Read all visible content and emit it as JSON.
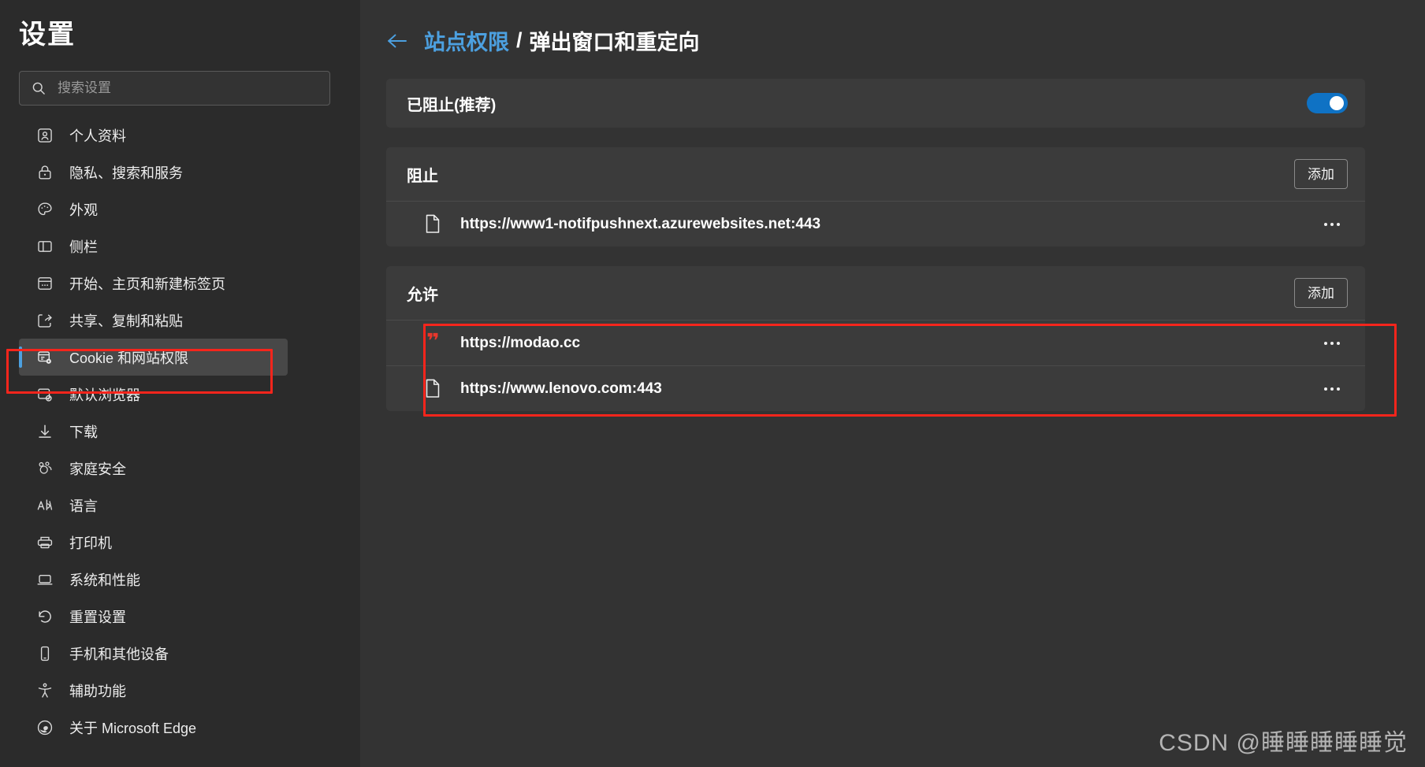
{
  "window": {
    "title": "设置",
    "theme_bg": "#333333",
    "sidebar_bg": "#2B2B2B",
    "card_bg": "#3B3B3B",
    "accent_color": "#4CA0E0",
    "toggle_on_color": "#0F72C4",
    "annotation_color": "#F6251C"
  },
  "sidebar": {
    "title": "设置",
    "search": {
      "placeholder": "搜索设置",
      "value": "",
      "icon": "search-icon"
    },
    "items": [
      {
        "label": "个人资料",
        "icon": "profile-icon",
        "selected": false
      },
      {
        "label": "隐私、搜索和服务",
        "icon": "lock-icon",
        "selected": false
      },
      {
        "label": "外观",
        "icon": "palette-icon",
        "selected": false
      },
      {
        "label": "侧栏",
        "icon": "sidebar-panel-icon",
        "selected": false
      },
      {
        "label": "开始、主页和新建标签页",
        "icon": "new-tab-icon",
        "selected": false
      },
      {
        "label": "共享、复制和粘贴",
        "icon": "share-icon",
        "selected": false
      },
      {
        "label": "Cookie 和网站权限",
        "icon": "cookie-settings-icon",
        "selected": true
      },
      {
        "label": "默认浏览器",
        "icon": "default-browser-icon",
        "selected": false
      },
      {
        "label": "下载",
        "icon": "download-icon",
        "selected": false
      },
      {
        "label": "家庭安全",
        "icon": "family-icon",
        "selected": false
      },
      {
        "label": "语言",
        "icon": "language-icon",
        "selected": false
      },
      {
        "label": "打印机",
        "icon": "printer-icon",
        "selected": false
      },
      {
        "label": "系统和性能",
        "icon": "laptop-icon",
        "selected": false
      },
      {
        "label": "重置设置",
        "icon": "reset-icon",
        "selected": false
      },
      {
        "label": "手机和其他设备",
        "icon": "phone-icon",
        "selected": false
      },
      {
        "label": "辅助功能",
        "icon": "accessibility-icon",
        "selected": false
      },
      {
        "label": "关于 Microsoft Edge",
        "icon": "edge-logo-icon",
        "selected": false
      }
    ]
  },
  "main": {
    "breadcrumb": {
      "back_icon": "back-arrow-icon",
      "parent": "站点权限",
      "separator": "/",
      "current": "弹出窗口和重定向"
    },
    "blocked_toggle_card": {
      "label": "已阻止(推荐)",
      "toggle_on": true
    },
    "sections": [
      {
        "title": "阻止",
        "add_label": "添加",
        "highlighted": false,
        "sites": [
          {
            "url": "https://www1-notifpushnext.azurewebsites.net:443",
            "favicon": "generic-page-icon",
            "more_label": "..."
          }
        ]
      },
      {
        "title": "允许",
        "add_label": "添加",
        "highlighted": true,
        "sites": [
          {
            "url": "https://modao.cc",
            "favicon": "modao-favicon",
            "favicon_glyph": "❞",
            "favicon_color": "#E8372C",
            "more_label": "..."
          },
          {
            "url": "https://www.lenovo.com:443",
            "favicon": "generic-page-icon",
            "more_label": "..."
          }
        ]
      }
    ]
  },
  "watermark": {
    "text": "CSDN @睡睡睡睡睡觉"
  }
}
